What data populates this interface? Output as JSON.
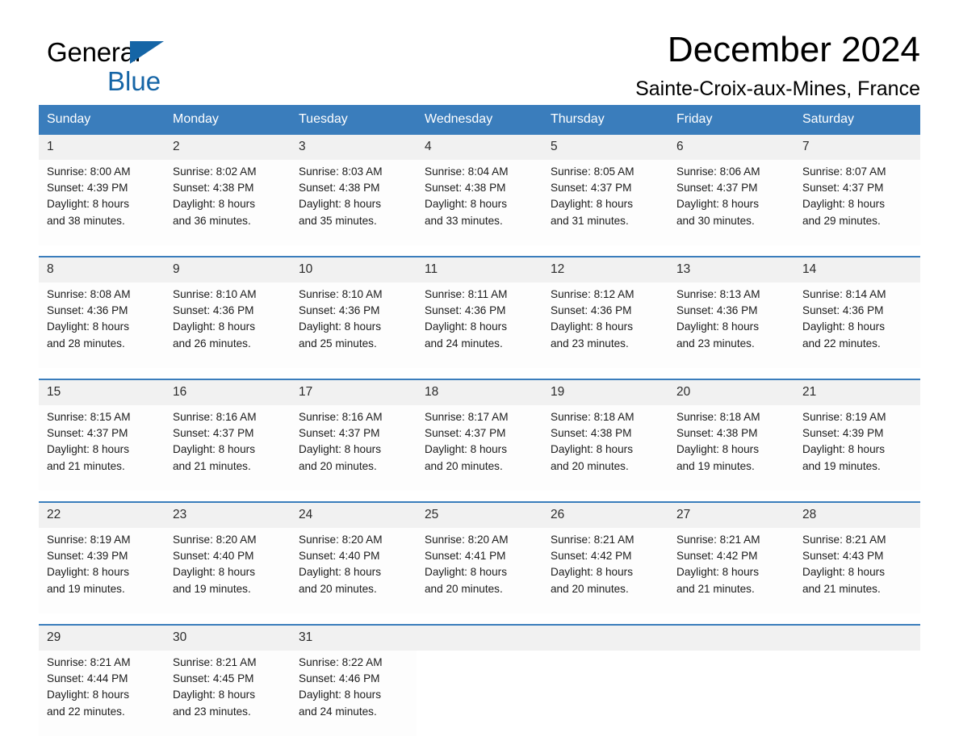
{
  "brand": {
    "line1": "General",
    "line2": "Blue",
    "triangle_icon": "blue-triangle-logo-mark",
    "accent_color": "#1565a6"
  },
  "header": {
    "title": "December 2024",
    "subtitle": "Sainte-Croix-aux-Mines, France"
  },
  "colors": {
    "header_blue": "#3a7dbc",
    "row_separator_blue": "#3a7dbc",
    "daynum_background": "#f1f1f1",
    "cell_background": "#fdfdfd",
    "text": "#1b1b1b"
  },
  "weekday_headers": [
    "Sunday",
    "Monday",
    "Tuesday",
    "Wednesday",
    "Thursday",
    "Friday",
    "Saturday"
  ],
  "weeks": [
    {
      "days": [
        {
          "day": "1",
          "sunrise": "Sunrise: 8:00 AM",
          "sunset": "Sunset: 4:39 PM",
          "daylight_line1": "Daylight: 8 hours",
          "daylight_line2": "and 38 minutes."
        },
        {
          "day": "2",
          "sunrise": "Sunrise: 8:02 AM",
          "sunset": "Sunset: 4:38 PM",
          "daylight_line1": "Daylight: 8 hours",
          "daylight_line2": "and 36 minutes."
        },
        {
          "day": "3",
          "sunrise": "Sunrise: 8:03 AM",
          "sunset": "Sunset: 4:38 PM",
          "daylight_line1": "Daylight: 8 hours",
          "daylight_line2": "and 35 minutes."
        },
        {
          "day": "4",
          "sunrise": "Sunrise: 8:04 AM",
          "sunset": "Sunset: 4:38 PM",
          "daylight_line1": "Daylight: 8 hours",
          "daylight_line2": "and 33 minutes."
        },
        {
          "day": "5",
          "sunrise": "Sunrise: 8:05 AM",
          "sunset": "Sunset: 4:37 PM",
          "daylight_line1": "Daylight: 8 hours",
          "daylight_line2": "and 31 minutes."
        },
        {
          "day": "6",
          "sunrise": "Sunrise: 8:06 AM",
          "sunset": "Sunset: 4:37 PM",
          "daylight_line1": "Daylight: 8 hours",
          "daylight_line2": "and 30 minutes."
        },
        {
          "day": "7",
          "sunrise": "Sunrise: 8:07 AM",
          "sunset": "Sunset: 4:37 PM",
          "daylight_line1": "Daylight: 8 hours",
          "daylight_line2": "and 29 minutes."
        }
      ]
    },
    {
      "days": [
        {
          "day": "8",
          "sunrise": "Sunrise: 8:08 AM",
          "sunset": "Sunset: 4:36 PM",
          "daylight_line1": "Daylight: 8 hours",
          "daylight_line2": "and 28 minutes."
        },
        {
          "day": "9",
          "sunrise": "Sunrise: 8:10 AM",
          "sunset": "Sunset: 4:36 PM",
          "daylight_line1": "Daylight: 8 hours",
          "daylight_line2": "and 26 minutes."
        },
        {
          "day": "10",
          "sunrise": "Sunrise: 8:10 AM",
          "sunset": "Sunset: 4:36 PM",
          "daylight_line1": "Daylight: 8 hours",
          "daylight_line2": "and 25 minutes."
        },
        {
          "day": "11",
          "sunrise": "Sunrise: 8:11 AM",
          "sunset": "Sunset: 4:36 PM",
          "daylight_line1": "Daylight: 8 hours",
          "daylight_line2": "and 24 minutes."
        },
        {
          "day": "12",
          "sunrise": "Sunrise: 8:12 AM",
          "sunset": "Sunset: 4:36 PM",
          "daylight_line1": "Daylight: 8 hours",
          "daylight_line2": "and 23 minutes."
        },
        {
          "day": "13",
          "sunrise": "Sunrise: 8:13 AM",
          "sunset": "Sunset: 4:36 PM",
          "daylight_line1": "Daylight: 8 hours",
          "daylight_line2": "and 23 minutes."
        },
        {
          "day": "14",
          "sunrise": "Sunrise: 8:14 AM",
          "sunset": "Sunset: 4:36 PM",
          "daylight_line1": "Daylight: 8 hours",
          "daylight_line2": "and 22 minutes."
        }
      ]
    },
    {
      "days": [
        {
          "day": "15",
          "sunrise": "Sunrise: 8:15 AM",
          "sunset": "Sunset: 4:37 PM",
          "daylight_line1": "Daylight: 8 hours",
          "daylight_line2": "and 21 minutes."
        },
        {
          "day": "16",
          "sunrise": "Sunrise: 8:16 AM",
          "sunset": "Sunset: 4:37 PM",
          "daylight_line1": "Daylight: 8 hours",
          "daylight_line2": "and 21 minutes."
        },
        {
          "day": "17",
          "sunrise": "Sunrise: 8:16 AM",
          "sunset": "Sunset: 4:37 PM",
          "daylight_line1": "Daylight: 8 hours",
          "daylight_line2": "and 20 minutes."
        },
        {
          "day": "18",
          "sunrise": "Sunrise: 8:17 AM",
          "sunset": "Sunset: 4:37 PM",
          "daylight_line1": "Daylight: 8 hours",
          "daylight_line2": "and 20 minutes."
        },
        {
          "day": "19",
          "sunrise": "Sunrise: 8:18 AM",
          "sunset": "Sunset: 4:38 PM",
          "daylight_line1": "Daylight: 8 hours",
          "daylight_line2": "and 20 minutes."
        },
        {
          "day": "20",
          "sunrise": "Sunrise: 8:18 AM",
          "sunset": "Sunset: 4:38 PM",
          "daylight_line1": "Daylight: 8 hours",
          "daylight_line2": "and 19 minutes."
        },
        {
          "day": "21",
          "sunrise": "Sunrise: 8:19 AM",
          "sunset": "Sunset: 4:39 PM",
          "daylight_line1": "Daylight: 8 hours",
          "daylight_line2": "and 19 minutes."
        }
      ]
    },
    {
      "days": [
        {
          "day": "22",
          "sunrise": "Sunrise: 8:19 AM",
          "sunset": "Sunset: 4:39 PM",
          "daylight_line1": "Daylight: 8 hours",
          "daylight_line2": "and 19 minutes."
        },
        {
          "day": "23",
          "sunrise": "Sunrise: 8:20 AM",
          "sunset": "Sunset: 4:40 PM",
          "daylight_line1": "Daylight: 8 hours",
          "daylight_line2": "and 19 minutes."
        },
        {
          "day": "24",
          "sunrise": "Sunrise: 8:20 AM",
          "sunset": "Sunset: 4:40 PM",
          "daylight_line1": "Daylight: 8 hours",
          "daylight_line2": "and 20 minutes."
        },
        {
          "day": "25",
          "sunrise": "Sunrise: 8:20 AM",
          "sunset": "Sunset: 4:41 PM",
          "daylight_line1": "Daylight: 8 hours",
          "daylight_line2": "and 20 minutes."
        },
        {
          "day": "26",
          "sunrise": "Sunrise: 8:21 AM",
          "sunset": "Sunset: 4:42 PM",
          "daylight_line1": "Daylight: 8 hours",
          "daylight_line2": "and 20 minutes."
        },
        {
          "day": "27",
          "sunrise": "Sunrise: 8:21 AM",
          "sunset": "Sunset: 4:42 PM",
          "daylight_line1": "Daylight: 8 hours",
          "daylight_line2": "and 21 minutes."
        },
        {
          "day": "28",
          "sunrise": "Sunrise: 8:21 AM",
          "sunset": "Sunset: 4:43 PM",
          "daylight_line1": "Daylight: 8 hours",
          "daylight_line2": "and 21 minutes."
        }
      ]
    },
    {
      "days": [
        {
          "day": "29",
          "sunrise": "Sunrise: 8:21 AM",
          "sunset": "Sunset: 4:44 PM",
          "daylight_line1": "Daylight: 8 hours",
          "daylight_line2": "and 22 minutes."
        },
        {
          "day": "30",
          "sunrise": "Sunrise: 8:21 AM",
          "sunset": "Sunset: 4:45 PM",
          "daylight_line1": "Daylight: 8 hours",
          "daylight_line2": "and 23 minutes."
        },
        {
          "day": "31",
          "sunrise": "Sunrise: 8:22 AM",
          "sunset": "Sunset: 4:46 PM",
          "daylight_line1": "Daylight: 8 hours",
          "daylight_line2": "and 24 minutes."
        },
        {
          "day": "",
          "sunrise": "",
          "sunset": "",
          "daylight_line1": "",
          "daylight_line2": ""
        },
        {
          "day": "",
          "sunrise": "",
          "sunset": "",
          "daylight_line1": "",
          "daylight_line2": ""
        },
        {
          "day": "",
          "sunrise": "",
          "sunset": "",
          "daylight_line1": "",
          "daylight_line2": ""
        },
        {
          "day": "",
          "sunrise": "",
          "sunset": "",
          "daylight_line1": "",
          "daylight_line2": ""
        }
      ]
    }
  ]
}
